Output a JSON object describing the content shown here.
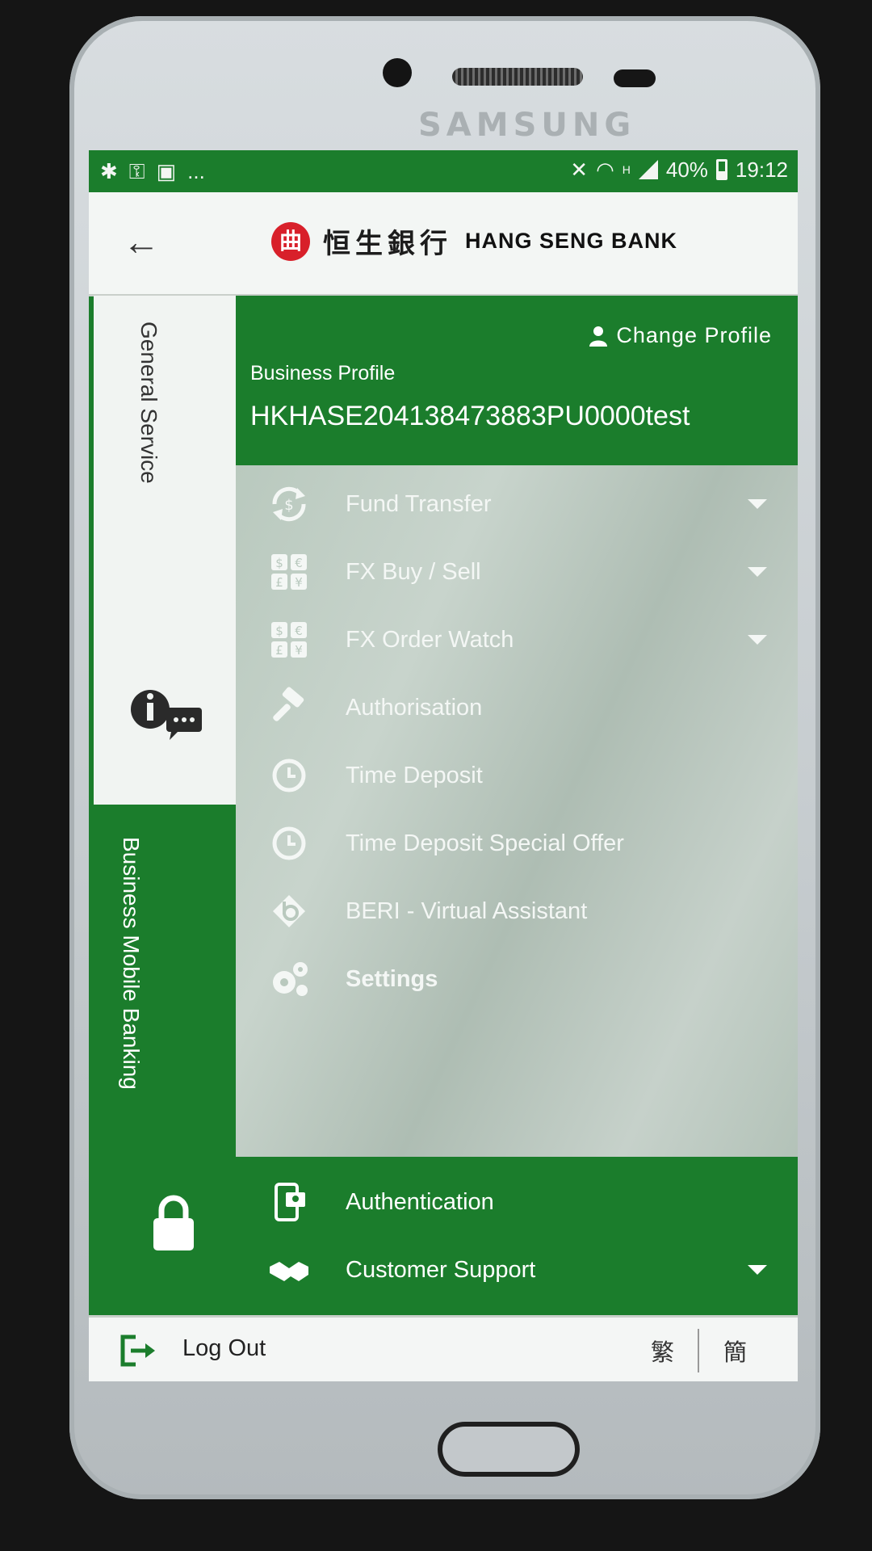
{
  "device": {
    "brand": "SAMSUNG"
  },
  "status_bar": {
    "left_icons": [
      "android-debug-icon",
      "key-icon",
      "bag-icon",
      "more-dots-icon"
    ],
    "more": "...",
    "network": "H",
    "battery": "40%",
    "time": "19:12"
  },
  "header": {
    "logo_cn": "恒生銀行",
    "logo_en": "HANG SENG BANK"
  },
  "sidebar": {
    "general_service": "General Service",
    "business_mobile_banking": "Business Mobile Banking"
  },
  "profile": {
    "change_profile": "Change Profile",
    "label": "Business Profile",
    "id": "HKHASE204138473883PU0000test"
  },
  "menu": {
    "items": [
      {
        "label": "Fund Transfer",
        "icon": "fund-transfer-icon",
        "expandable": true
      },
      {
        "label": "FX Buy / Sell",
        "icon": "currency-icon",
        "expandable": true
      },
      {
        "label": "FX Order Watch",
        "icon": "currency-icon",
        "expandable": true
      },
      {
        "label": "Authorisation",
        "icon": "gavel-icon",
        "expandable": false
      },
      {
        "label": "Time Deposit",
        "icon": "clock-icon",
        "expandable": false
      },
      {
        "label": "Time Deposit Special Offer",
        "icon": "clock-icon",
        "expandable": false
      },
      {
        "label": "BERI - Virtual Assistant",
        "icon": "assistant-icon",
        "expandable": false
      },
      {
        "label": "Settings",
        "icon": "gears-icon",
        "expandable": false
      }
    ],
    "dark_items": [
      {
        "label": "Authentication",
        "icon": "mobile-auth-icon",
        "expandable": false
      },
      {
        "label": "Customer Support",
        "icon": "handshake-icon",
        "expandable": true
      }
    ]
  },
  "footer": {
    "logout": "Log Out",
    "lang_traditional": "繁",
    "lang_simplified": "簡"
  },
  "colors": {
    "brand_green": "#1b7d2c",
    "logo_red": "#d8202a",
    "menu_overlay": "#bfcdc4"
  }
}
